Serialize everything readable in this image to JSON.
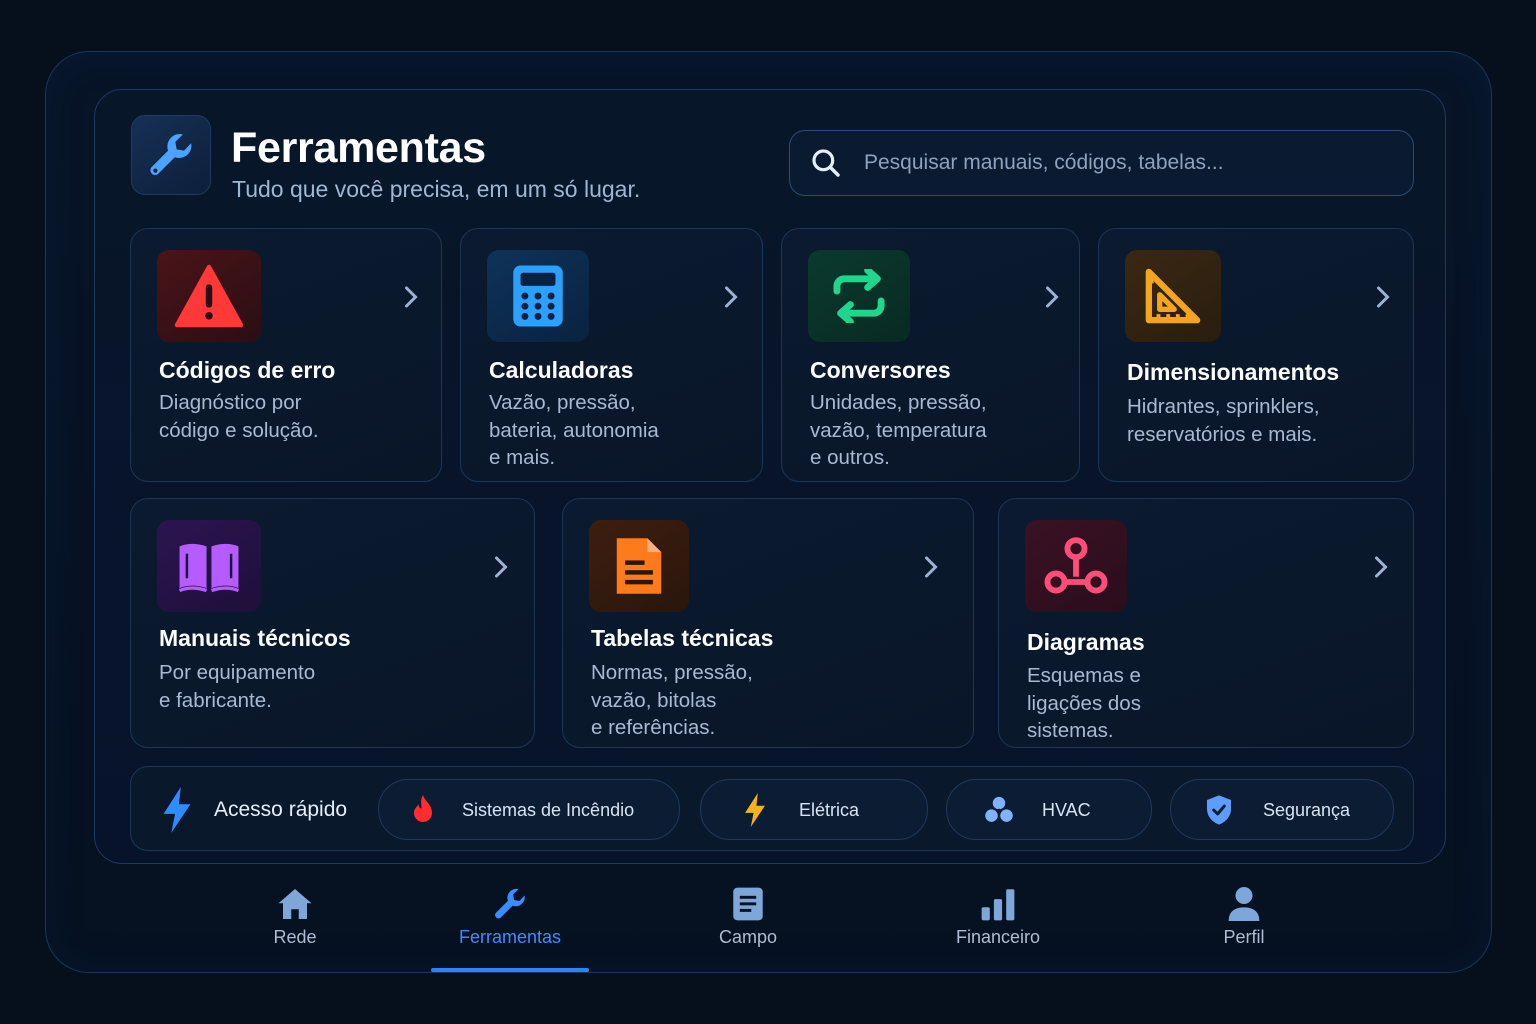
{
  "header": {
    "title": "Ferramentas",
    "subtitle": "Tudo que você precisa, em um só lugar.",
    "icon": "wrench-icon"
  },
  "search": {
    "placeholder": "Pesquisar manuais, códigos, tabelas..."
  },
  "cards": [
    {
      "title": "Códigos de erro",
      "desc": "Diagnóstico por\ncódigo e solução.",
      "icon": "warning-icon",
      "color": "#ff3a3a"
    },
    {
      "title": "Calculadoras",
      "desc": "Vazão, pressão,\nbateria, autonomia\ne mais.",
      "icon": "calculator-icon",
      "color": "#2ba0ff"
    },
    {
      "title": "Conversores",
      "desc": "Unidades, pressão,\nvazão, temperatura\ne outros.",
      "icon": "swap-arrows-icon",
      "color": "#1fd68c"
    },
    {
      "title": "Dimensionamentos",
      "desc": "Hidrantes, sprinklers,\nreservatórios e mais.",
      "icon": "set-square-icon",
      "color": "#f2a51d"
    },
    {
      "title": "Manuais técnicos",
      "desc": "Por equipamento\ne fabricante.",
      "icon": "book-icon",
      "color": "#b45cff"
    },
    {
      "title": "Tabelas técnicas",
      "desc": "Normas, pressão,\nvazão, bitolas\ne referências.",
      "icon": "document-icon",
      "color": "#ff7a1a"
    },
    {
      "title": "Diagramas",
      "desc": "Esquemas e\nligações dos\nsistemas.",
      "icon": "network-icon",
      "color": "#ff4d7a"
    }
  ],
  "quick_access": {
    "label": "Acesso rápido",
    "items": [
      {
        "label": "Sistemas de Incêndio",
        "icon": "fire-icon"
      },
      {
        "label": "Elétrica",
        "icon": "lightning-icon"
      },
      {
        "label": "HVAC",
        "icon": "fan-icon"
      },
      {
        "label": "Segurança",
        "icon": "shield-icon"
      }
    ]
  },
  "nav": {
    "items": [
      {
        "label": "Rede",
        "icon": "home-icon"
      },
      {
        "label": "Ferramentas",
        "icon": "wrench-icon",
        "active": true
      },
      {
        "label": "Campo",
        "icon": "document-icon"
      },
      {
        "label": "Financeiro",
        "icon": "bar-chart-icon"
      },
      {
        "label": "Perfil",
        "icon": "user-icon"
      }
    ]
  },
  "colors": {
    "accent": "#2f82ff",
    "background": "#06101c"
  }
}
